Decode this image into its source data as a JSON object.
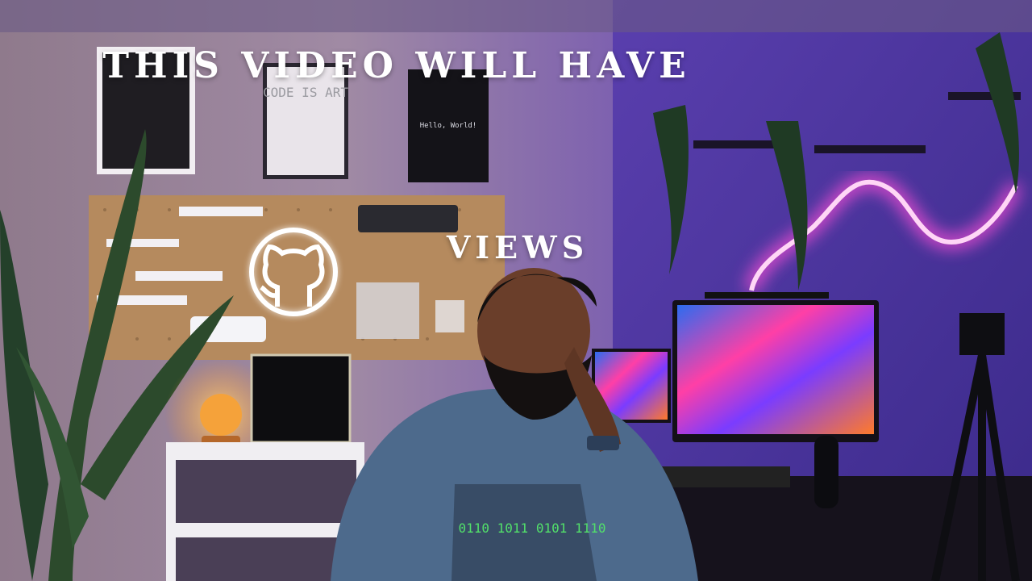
{
  "overlay": {
    "line1": "THIS VIDEO WILL HAVE",
    "line2": "VIEWS"
  },
  "poster_code": {
    "text": "CODE IS ART"
  },
  "poster_hello": {
    "text": "Hello, World!"
  },
  "binary_print": {
    "text": "0110 1011 0101 1110"
  },
  "colors": {
    "wall_pink": "#9a7f95",
    "wall_purple": "#5b3aa8",
    "neon": "#ff4fd8",
    "hoodie": "#4d6a8c",
    "lamp": "#f5a23a",
    "pegboard": "#b58a5e"
  },
  "icons": {
    "github_neon": "github-octocat-icon"
  }
}
